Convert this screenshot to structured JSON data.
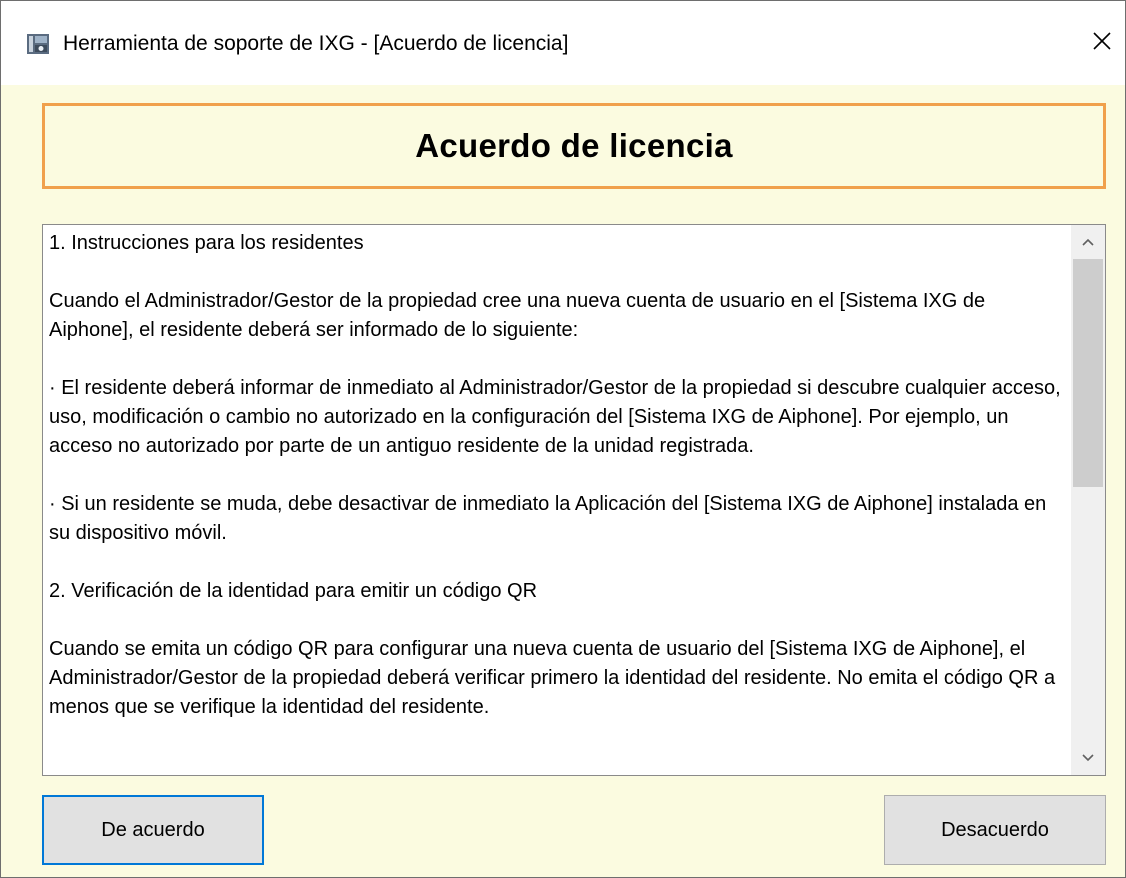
{
  "window": {
    "title": "Herramienta de soporte de IXG - [Acuerdo de licencia]",
    "app_icon": "app-window-icon",
    "close_icon": "close-icon"
  },
  "banner": {
    "title": "Acuerdo de licencia",
    "border_color": "#f0a04c",
    "background_color": "#fbfbe0"
  },
  "license_text": {
    "paragraphs": [
      "1. Instrucciones para los residentes",
      "Cuando el Administrador/Gestor de la propiedad cree una nueva cuenta de usuario en el [Sistema IXG de Aiphone], el residente deberá ser informado de lo siguiente:",
      "· El residente deberá informar de inmediato al Administrador/Gestor de la propiedad si descubre cualquier acceso, uso, modificación o cambio no autorizado en la configuración del [Sistema IXG de Aiphone]. Por ejemplo, un acceso no autorizado por parte de un antiguo residente de la unidad registrada.",
      "· Si un residente se muda, debe desactivar de inmediato la Aplicación del [Sistema IXG de Aiphone] instalada en su dispositivo móvil.",
      "2. Verificación de la identidad para emitir un código QR",
      "Cuando se emita un código QR para configurar una nueva cuenta de usuario del [Sistema IXG de Aiphone], el Administrador/Gestor de la propiedad deberá verificar primero la identidad del residente. No emita el código QR a menos que se verifique la identidad del residente."
    ],
    "scroll_position": 0.0
  },
  "buttons": {
    "agree_label": "De acuerdo",
    "disagree_label": "Desacuerdo",
    "focus_color": "#0078d7"
  }
}
